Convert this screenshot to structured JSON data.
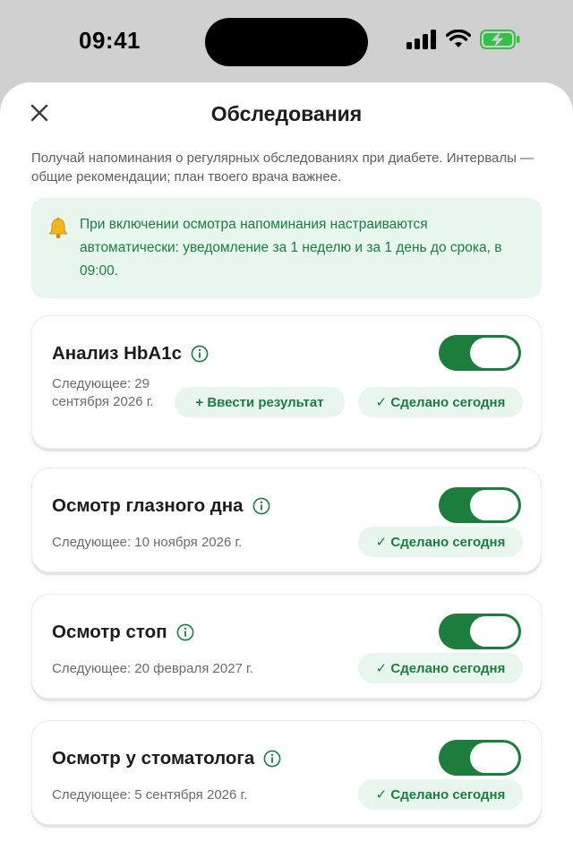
{
  "status_bar": {
    "time": "09:41"
  },
  "header": {
    "title": "Обследования",
    "close_icon": "close-icon"
  },
  "intro": "Получай напоминания о регулярных обследованиях при диабете. Интервалы — общие рекомендации; план твоего врача важнее.",
  "notice": {
    "icon": "bell-icon",
    "text": "При включении осмотра напоминания настраиваются автоматически: уведомление за 1 неделю и за 1 день до срока, в 09:00."
  },
  "colors": {
    "accent": "#1c7d3c",
    "accent_light": "#e8f6ee",
    "battery": "#36c04a"
  },
  "cards": [
    {
      "title": "Анализ HbA1c",
      "next": "Следующее: 29 сентября 2026 г.",
      "enabled": true,
      "enter_result_label": "+ Ввести результат",
      "done_label": "✓ Сделано сегодня"
    },
    {
      "title": "Осмотр глазного дна",
      "next": "Следующее: 10 ноября 2026 г.",
      "enabled": true,
      "done_label": "✓ Сделано сегодня"
    },
    {
      "title": "Осмотр стоп",
      "next": "Следующее: 20 февраля 2027 г.",
      "enabled": true,
      "done_label": "✓ Сделано сегодня"
    },
    {
      "title": "Осмотр у стоматолога",
      "next": "Следующее: 5 сентября 2026 г.",
      "enabled": true,
      "done_label": "✓ Сделано сегодня"
    }
  ]
}
